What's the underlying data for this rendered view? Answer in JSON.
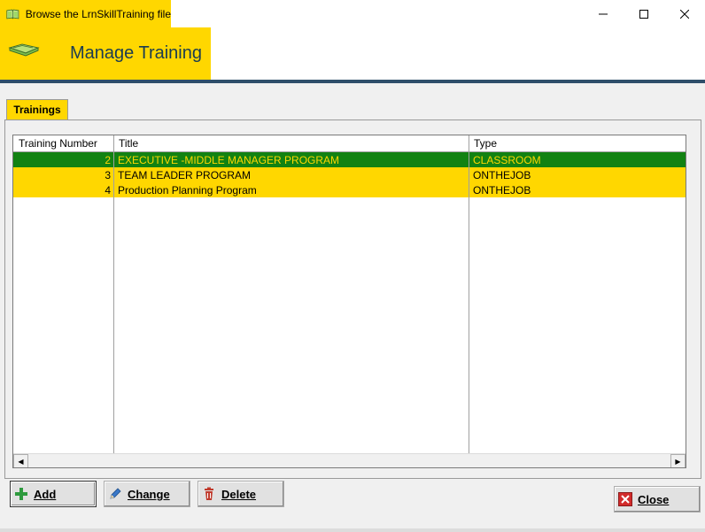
{
  "window": {
    "title": "Browse the LrnSkillTraining file",
    "minimize_glyph": "—",
    "maximize_glyph": "☐",
    "close_glyph": "✕"
  },
  "banner": {
    "title": "Manage Training",
    "icon": "book-icon"
  },
  "tabs": [
    {
      "label": "Trainings",
      "active": true
    }
  ],
  "grid": {
    "columns": [
      "Training Number",
      "Title",
      "Type"
    ],
    "rows": [
      {
        "number": "2",
        "title": "EXECUTIVE -MIDDLE MANAGER PROGRAM",
        "type": "CLASSROOM",
        "selected": true
      },
      {
        "number": "3",
        "title": "TEAM LEADER PROGRAM",
        "type": "ONTHEJOB",
        "selected": false
      },
      {
        "number": "4",
        "title": "Production Planning Program",
        "type": "ONTHEJOB",
        "selected": false
      }
    ],
    "scroll_left_glyph": "◀",
    "scroll_right_glyph": "▶"
  },
  "buttons": {
    "add": {
      "label": "Add",
      "icon": "plus-icon"
    },
    "change": {
      "label": "Change",
      "icon": "pencil-icon"
    },
    "delete": {
      "label": "Delete",
      "icon": "trash-icon"
    },
    "close": {
      "label": "Close",
      "icon": "close-x-icon"
    }
  },
  "colors": {
    "accent_yellow": "#ffd700",
    "selected_row": "#128212",
    "banner_text": "#1a3c52",
    "divider": "#2e4e6a"
  }
}
